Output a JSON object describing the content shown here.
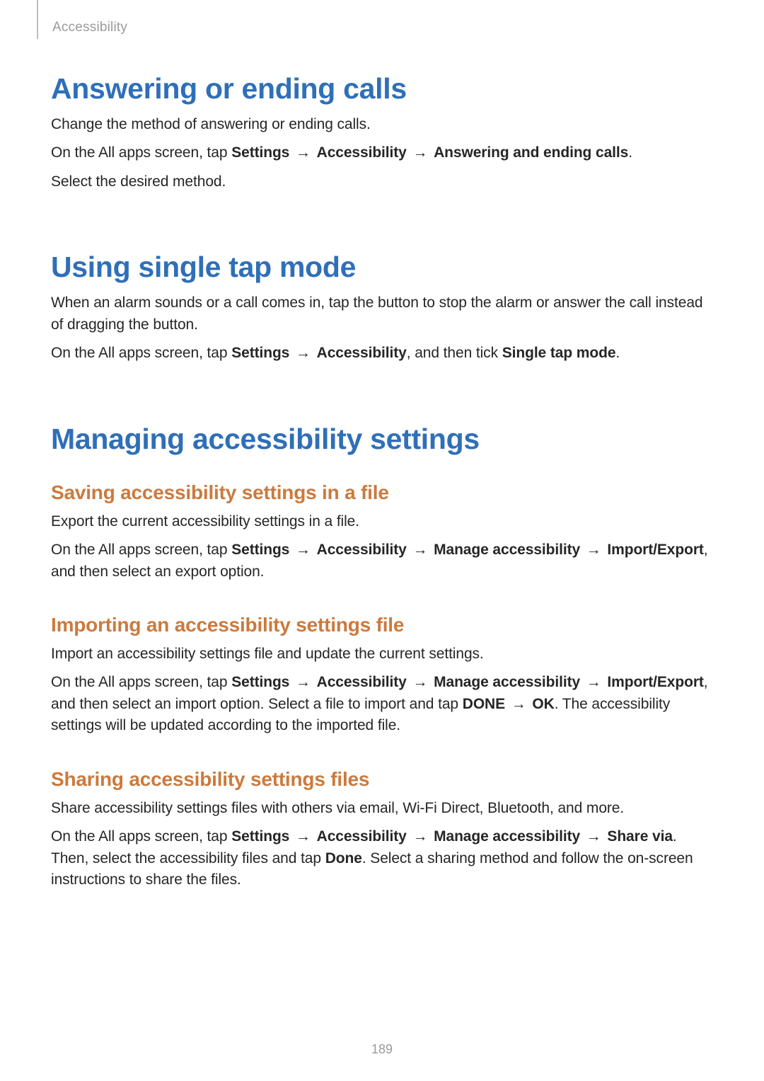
{
  "page": {
    "running_head": "Accessibility",
    "number": "189"
  },
  "sec1": {
    "title": "Answering or ending calls",
    "p1": "Change the method of answering or ending calls.",
    "p2": {
      "a": "On the All apps screen, tap ",
      "nav1": "Settings",
      "arr": " → ",
      "nav2": "Accessibility",
      "nav3": "Answering and ending calls",
      "z": "."
    },
    "p3": "Select the desired method."
  },
  "sec2": {
    "title": "Using single tap mode",
    "p1": "When an alarm sounds or a call comes in, tap the button to stop the alarm or answer the call instead of dragging the button.",
    "p2": {
      "a": "On the All apps screen, tap ",
      "nav1": "Settings",
      "arr": " → ",
      "nav2": "Accessibility",
      "b": ", and then tick ",
      "nav3": "Single tap mode",
      "z": "."
    }
  },
  "sec3": {
    "title": "Managing accessibility settings",
    "sub1": {
      "title": "Saving accessibility settings in a file",
      "p1": "Export the current accessibility settings in a file.",
      "p2": {
        "a": "On the All apps screen, tap ",
        "nav1": "Settings",
        "arr": " → ",
        "nav2": "Accessibility",
        "nav3": "Manage accessibility",
        "nav4": "Import/Export",
        "z": ", and then select an export option."
      }
    },
    "sub2": {
      "title": "Importing an accessibility settings file",
      "p1": "Import an accessibility settings file and update the current settings.",
      "p2": {
        "a": "On the All apps screen, tap ",
        "nav1": "Settings",
        "arr": " → ",
        "nav2": "Accessibility",
        "nav3": "Manage accessibility",
        "nav4": "Import/Export",
        "b": ", and then select an import option. Select a file to import and tap ",
        "nav5": "DONE",
        "nav6": "OK",
        "c": ". The accessibility settings will be updated according to the imported file."
      }
    },
    "sub3": {
      "title": "Sharing accessibility settings files",
      "p1": "Share accessibility settings files with others via email, Wi-Fi Direct, Bluetooth, and more.",
      "p2": {
        "a": "On the All apps screen, tap ",
        "nav1": "Settings",
        "arr": " → ",
        "nav2": "Accessibility",
        "nav3": "Manage accessibility",
        "nav4": "Share via",
        "b": ". Then, select the accessibility files and tap ",
        "nav5": "Done",
        "c": ". Select a sharing method and follow the on-screen instructions to share the files."
      }
    }
  }
}
